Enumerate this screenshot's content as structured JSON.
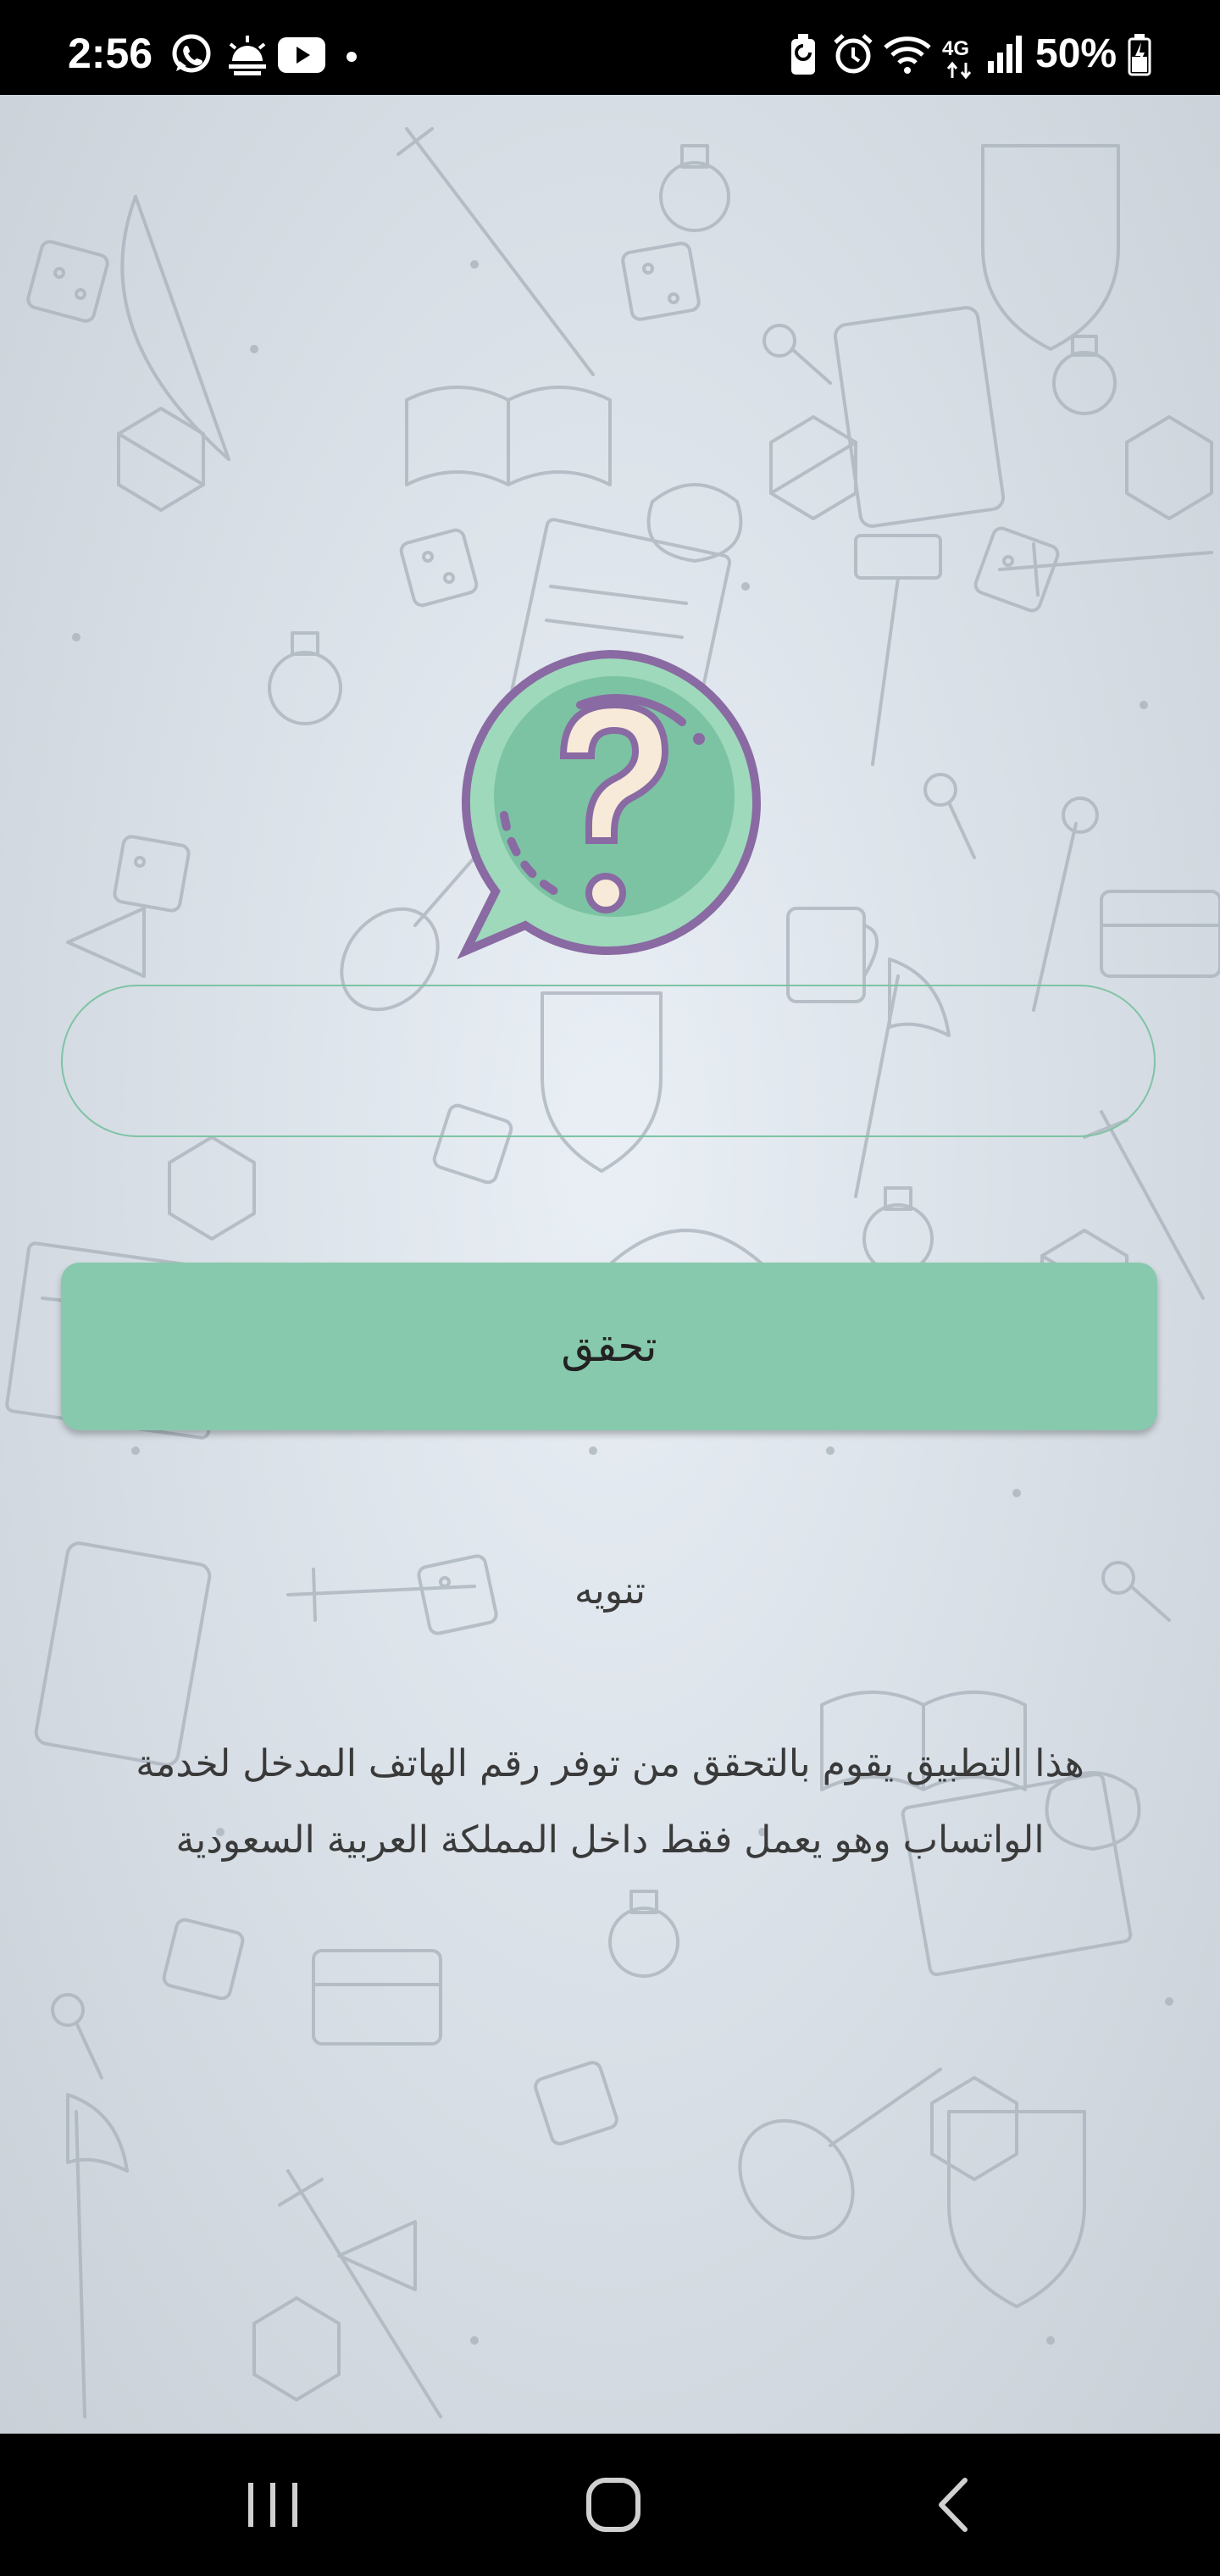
{
  "status_bar": {
    "time": "2:56",
    "network": "4G",
    "battery": "50%",
    "left_icons": [
      "whatsapp-icon",
      "weather-icon",
      "youtube-icon",
      "dot-icon"
    ],
    "right_icons": [
      "battery-saver-icon",
      "alarm-icon",
      "wifi-icon",
      "4g-icon",
      "signal-icon",
      "battery-icon"
    ]
  },
  "logo": {
    "icon": "question-bubble-icon",
    "colors": {
      "bubble": "#9ed9bb",
      "inner": "#7cc3a4",
      "outline": "#8a6aa3",
      "mark": "#f7ead9"
    }
  },
  "phone_input": {
    "value": "",
    "placeholder": ""
  },
  "verify_button": {
    "label": "تحقق",
    "color": "#87c9ad"
  },
  "notice": {
    "title": "تنويه",
    "line1": "هذا التطبيق يقوم بالتحقق من توفر رقم الهاتف المدخل لخدمة",
    "line2": "الواتساب وهو يعمل فقط داخل المملكة العربية السعودية"
  },
  "nav_bar": {
    "buttons": [
      "recent-apps-icon",
      "home-icon",
      "back-icon"
    ]
  }
}
